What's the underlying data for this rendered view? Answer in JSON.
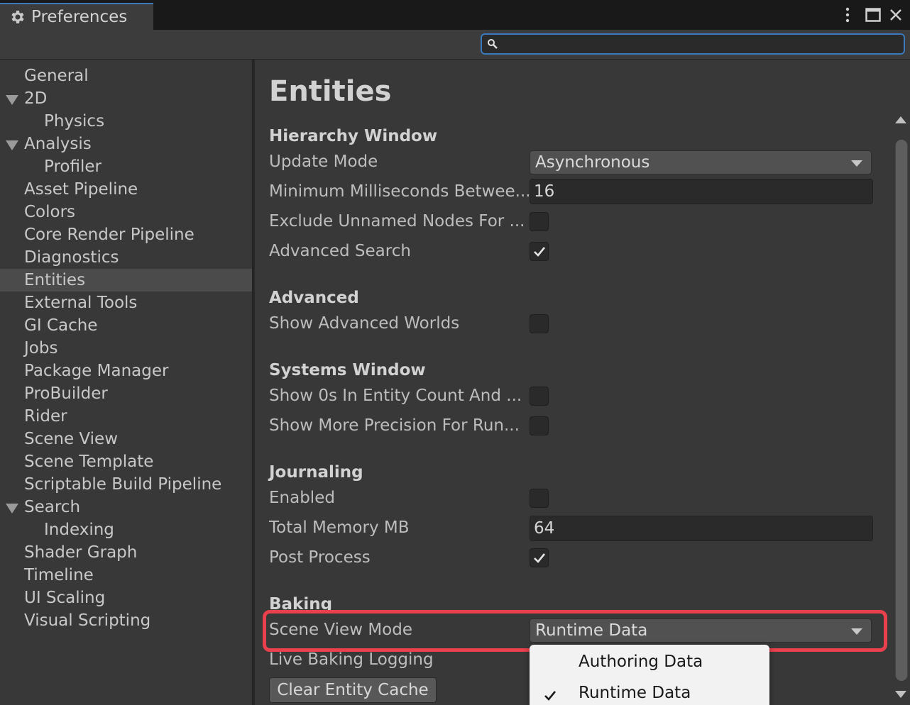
{
  "window": {
    "tab_label": "Preferences",
    "tab_icon": "gear-icon"
  },
  "search": {
    "placeholder": "",
    "value": ""
  },
  "sidebar": {
    "items": [
      {
        "label": "General",
        "level": 0,
        "expanded": null,
        "selected": false
      },
      {
        "label": "2D",
        "level": 0,
        "expanded": true,
        "selected": false
      },
      {
        "label": "Physics",
        "level": 1,
        "expanded": null,
        "selected": false
      },
      {
        "label": "Analysis",
        "level": 0,
        "expanded": true,
        "selected": false
      },
      {
        "label": "Profiler",
        "level": 1,
        "expanded": null,
        "selected": false
      },
      {
        "label": "Asset Pipeline",
        "level": 0,
        "expanded": null,
        "selected": false
      },
      {
        "label": "Colors",
        "level": 0,
        "expanded": null,
        "selected": false
      },
      {
        "label": "Core Render Pipeline",
        "level": 0,
        "expanded": null,
        "selected": false
      },
      {
        "label": "Diagnostics",
        "level": 0,
        "expanded": null,
        "selected": false
      },
      {
        "label": "Entities",
        "level": 0,
        "expanded": null,
        "selected": true
      },
      {
        "label": "External Tools",
        "level": 0,
        "expanded": null,
        "selected": false
      },
      {
        "label": "GI Cache",
        "level": 0,
        "expanded": null,
        "selected": false
      },
      {
        "label": "Jobs",
        "level": 0,
        "expanded": null,
        "selected": false
      },
      {
        "label": "Package Manager",
        "level": 0,
        "expanded": null,
        "selected": false
      },
      {
        "label": "ProBuilder",
        "level": 0,
        "expanded": null,
        "selected": false
      },
      {
        "label": "Rider",
        "level": 0,
        "expanded": null,
        "selected": false
      },
      {
        "label": "Scene View",
        "level": 0,
        "expanded": null,
        "selected": false
      },
      {
        "label": "Scene Template",
        "level": 0,
        "expanded": null,
        "selected": false
      },
      {
        "label": "Scriptable Build Pipeline",
        "level": 0,
        "expanded": null,
        "selected": false
      },
      {
        "label": "Search",
        "level": 0,
        "expanded": true,
        "selected": false
      },
      {
        "label": "Indexing",
        "level": 1,
        "expanded": null,
        "selected": false
      },
      {
        "label": "Shader Graph",
        "level": 0,
        "expanded": null,
        "selected": false
      },
      {
        "label": "Timeline",
        "level": 0,
        "expanded": null,
        "selected": false
      },
      {
        "label": "UI Scaling",
        "level": 0,
        "expanded": null,
        "selected": false
      },
      {
        "label": "Visual Scripting",
        "level": 0,
        "expanded": null,
        "selected": false
      }
    ]
  },
  "main": {
    "title": "Entities",
    "hierarchy": {
      "heading": "Hierarchy Window",
      "update_mode_label": "Update Mode",
      "update_mode_value": "Asynchronous",
      "min_ms_label": "Minimum Milliseconds Betwee...",
      "min_ms_value": "16",
      "exclude_label": "Exclude Unnamed Nodes For ...",
      "exclude_checked": false,
      "adv_search_label": "Advanced Search",
      "adv_search_checked": true
    },
    "advanced": {
      "heading": "Advanced",
      "show_worlds_label": "Show Advanced Worlds",
      "show_worlds_checked": false
    },
    "systems": {
      "heading": "Systems Window",
      "show_0s_label": "Show 0s In Entity Count And ...",
      "show_0s_checked": false,
      "precision_label": "Show More Precision For Run...",
      "precision_checked": false
    },
    "journaling": {
      "heading": "Journaling",
      "enabled_label": "Enabled",
      "enabled_checked": false,
      "memory_label": "Total Memory MB",
      "memory_value": "64",
      "post_process_label": "Post Process",
      "post_process_checked": true
    },
    "baking": {
      "heading": "Baking",
      "scene_view_mode_label": "Scene View Mode",
      "scene_view_mode_value": "Runtime Data",
      "live_logging_label": "Live Baking Logging",
      "clear_cache_label": "Clear Entity Cache"
    }
  },
  "popup": {
    "options": [
      {
        "label": "Authoring Data",
        "checked": false
      },
      {
        "label": "Runtime Data",
        "checked": true
      }
    ]
  },
  "colors": {
    "accent": "#3a79bb",
    "highlight": "#e8404c",
    "background": "#383838"
  }
}
